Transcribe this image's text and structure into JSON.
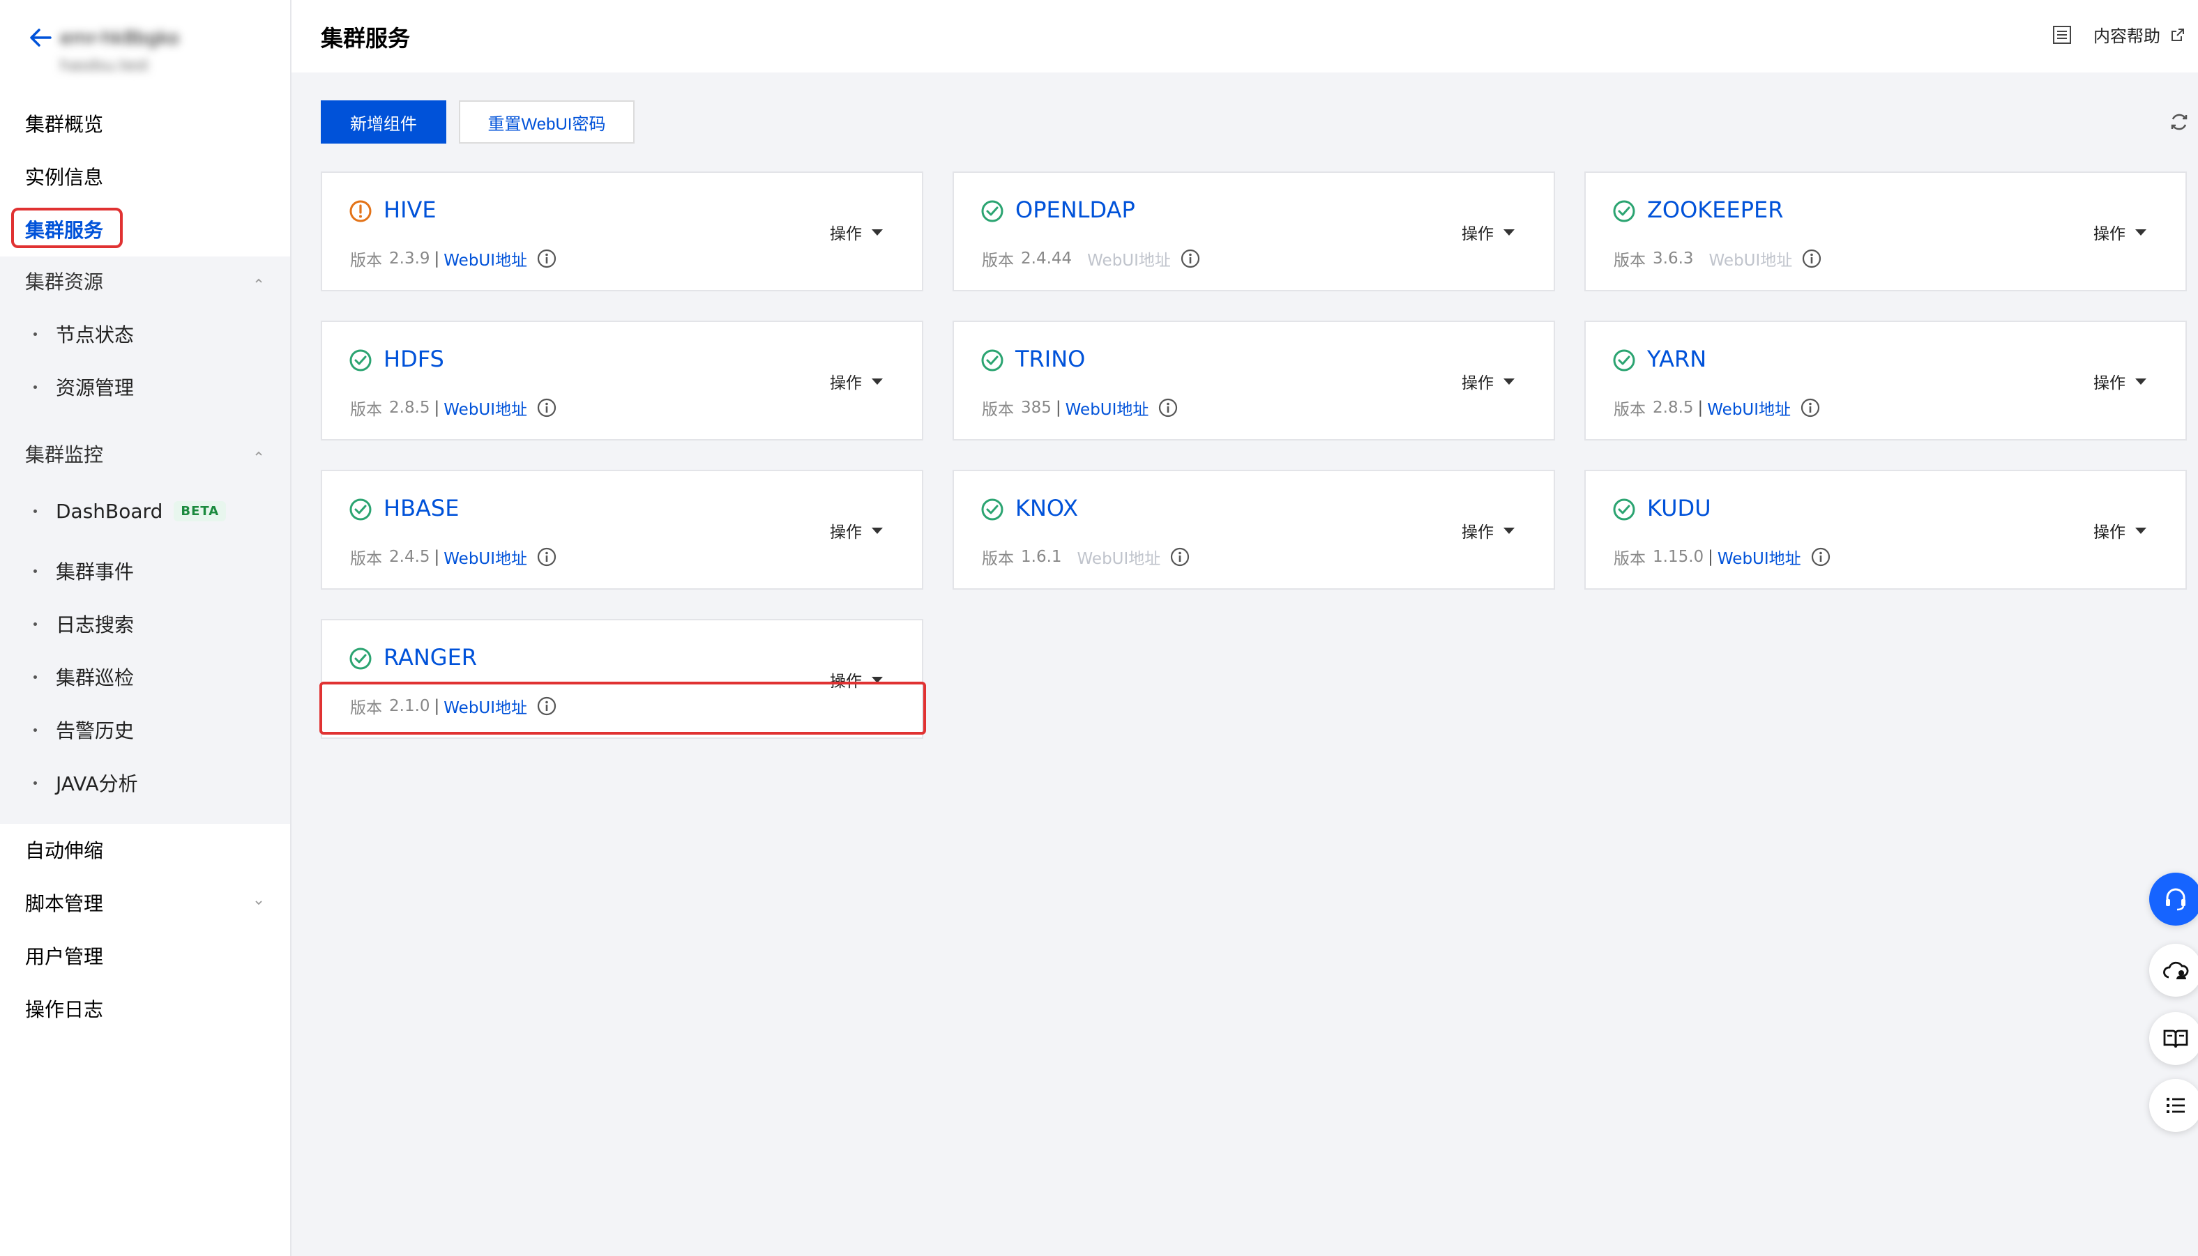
{
  "sidebar": {
    "back_label": "←",
    "cluster_name": "emr-hk8bgko",
    "cluster_id": "hasdsu.test",
    "items": {
      "overview": "集群概览",
      "instance": "实例信息",
      "services": "集群服务",
      "resources": "集群资源",
      "node_status": "节点状态",
      "resource_mgmt": "资源管理",
      "monitor": "集群监控",
      "dashboard": "DashBoard",
      "dashboard_badge": "BETA",
      "events": "集群事件",
      "log_search": "日志搜索",
      "inspection": "集群巡检",
      "alert_history": "告警历史",
      "java_analysis": "JAVA分析",
      "autoscale": "自动伸缩",
      "scripts": "脚本管理",
      "users": "用户管理",
      "op_log": "操作日志"
    }
  },
  "header": {
    "title": "集群服务",
    "help": "内容帮助"
  },
  "toolbar": {
    "add_component": "新增组件",
    "reset_webui_pwd": "重置WebUI密码"
  },
  "cards": [
    {
      "name": "HIVE",
      "status": "warning",
      "version_label": "版本",
      "version": "2.3.9",
      "webui": "WebUI地址",
      "webui_enabled": true,
      "action": "操作"
    },
    {
      "name": "OPENLDAP",
      "status": "ok",
      "version_label": "版本",
      "version": "2.4.44",
      "webui": "WebUI地址",
      "webui_enabled": false,
      "action": "操作"
    },
    {
      "name": "ZOOKEEPER",
      "status": "ok",
      "version_label": "版本",
      "version": "3.6.3",
      "webui": "WebUI地址",
      "webui_enabled": false,
      "action": "操作"
    },
    {
      "name": "HDFS",
      "status": "ok",
      "version_label": "版本",
      "version": "2.8.5",
      "webui": "WebUI地址",
      "webui_enabled": true,
      "action": "操作"
    },
    {
      "name": "TRINO",
      "status": "ok",
      "version_label": "版本",
      "version": "385",
      "webui": "WebUI地址",
      "webui_enabled": true,
      "action": "操作"
    },
    {
      "name": "YARN",
      "status": "ok",
      "version_label": "版本",
      "version": "2.8.5",
      "webui": "WebUI地址",
      "webui_enabled": true,
      "action": "操作"
    },
    {
      "name": "HBASE",
      "status": "ok",
      "version_label": "版本",
      "version": "2.4.5",
      "webui": "WebUI地址",
      "webui_enabled": true,
      "action": "操作"
    },
    {
      "name": "KNOX",
      "status": "ok",
      "version_label": "版本",
      "version": "1.6.1",
      "webui": "WebUI地址",
      "webui_enabled": false,
      "action": "操作"
    },
    {
      "name": "KUDU",
      "status": "ok",
      "version_label": "版本",
      "version": "1.15.0",
      "webui": "WebUI地址",
      "webui_enabled": true,
      "action": "操作"
    },
    {
      "name": "RANGER",
      "status": "ok",
      "version_label": "版本",
      "version": "2.1.0",
      "webui": "WebUI地址",
      "webui_enabled": true,
      "action": "操作"
    }
  ],
  "colors": {
    "accent": "#0052d9",
    "ok": "#2ba471",
    "warning": "#e37318",
    "highlight": "#e03232"
  },
  "floating_tools": [
    "headset-icon",
    "cloud-user-icon",
    "book-icon",
    "list-icon"
  ]
}
